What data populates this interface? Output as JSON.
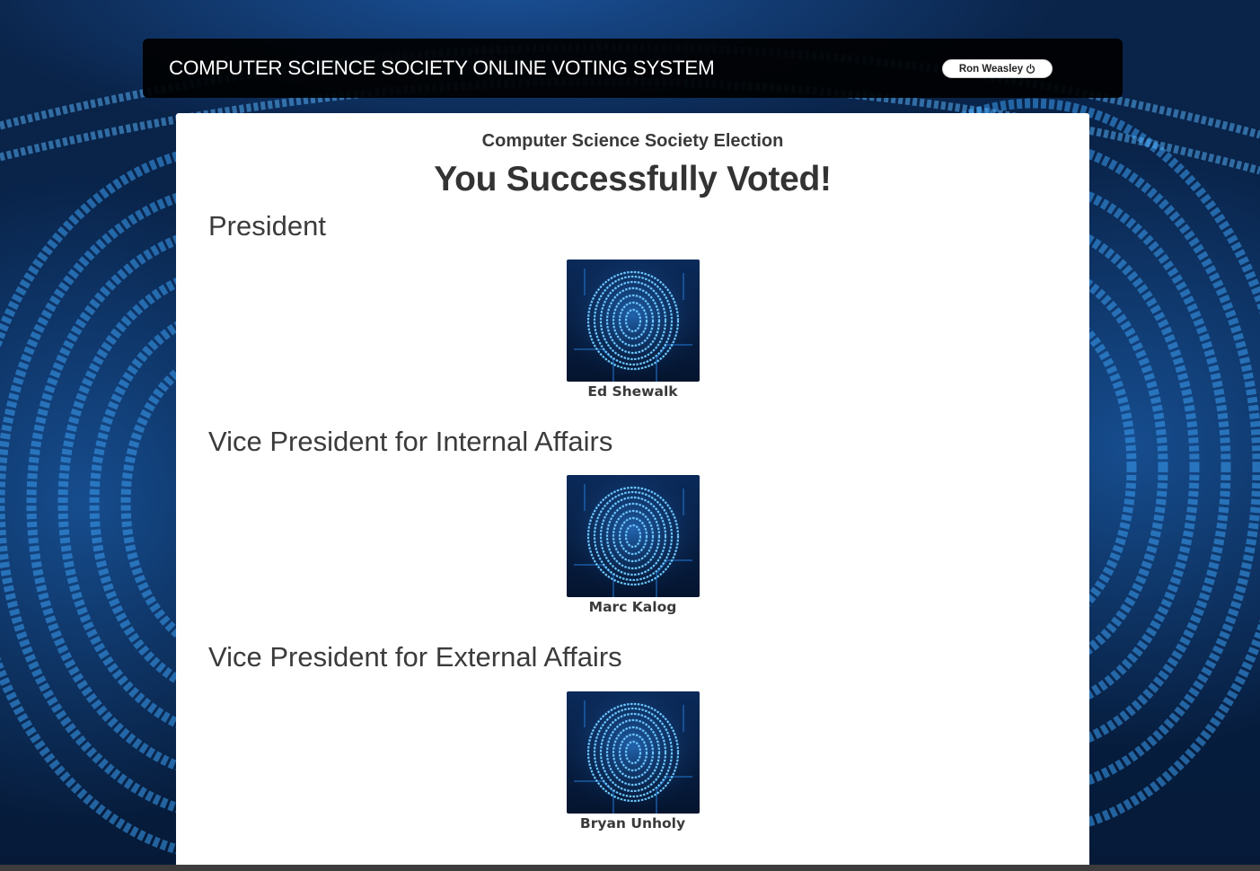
{
  "header": {
    "title": "COMPUTER SCIENCE SOCIETY ONLINE VOTING SYSTEM",
    "user_name": "Ron Weasley",
    "logout_icon": "power-icon"
  },
  "main": {
    "election_title": "Computer Science Society Election",
    "success_heading": "You Successfully Voted!",
    "positions": [
      {
        "title": "President",
        "candidate": "Ed Shewalk",
        "photo_icon": "fingerprint-image"
      },
      {
        "title": "Vice President for Internal Affairs",
        "candidate": "Marc Kalog",
        "photo_icon": "fingerprint-image"
      },
      {
        "title": "Vice President for External Affairs",
        "candidate": "Bryan Unholy",
        "photo_icon": "fingerprint-image"
      }
    ]
  },
  "colors": {
    "header_bg": "#000000",
    "card_bg": "#ffffff",
    "accent_blue": "#2f9bff",
    "text_dark": "#333333"
  }
}
